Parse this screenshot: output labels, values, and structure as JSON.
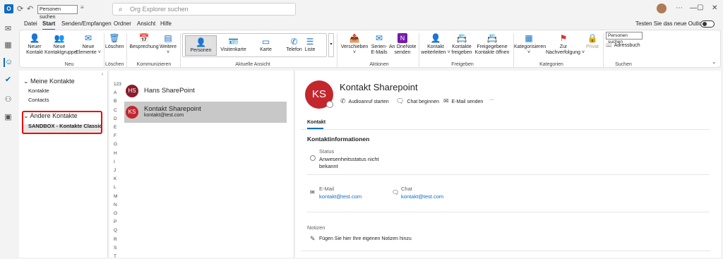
{
  "titlebar": {
    "quick_search": "Personen suchen",
    "search_placeholder": "Org Explorer suchen"
  },
  "menu": {
    "tabs": [
      "Datei",
      "Start",
      "Senden/Empfangen",
      "Ordner",
      "Ansicht",
      "Hilfe"
    ],
    "active_tab": "Start",
    "try_new": "Testen Sie das neue Outlook"
  },
  "ribbon": {
    "neu": {
      "group": "Neu",
      "new_contact": [
        "Neuer",
        "Kontakt"
      ],
      "new_group": [
        "Neue",
        "Kontaktgruppe"
      ],
      "new_items": [
        "Neue",
        "Elemente ˅"
      ]
    },
    "loeschen": {
      "group": "Löschen",
      "delete": "Löschen"
    },
    "kommunikation": {
      "group": "Kommunizieren",
      "meeting": "Besprechung",
      "more": [
        "Weitere",
        "˅"
      ]
    },
    "ansicht": {
      "group": "Aktuelle Ansicht",
      "views": [
        "Personen",
        "Visitenkarte",
        "Karte",
        "Telefon",
        "Liste"
      ]
    },
    "aktionen": {
      "group": "Aktionen",
      "move": [
        "Verschieben",
        "˅"
      ],
      "mail": [
        "Serien-",
        "E-Mails"
      ],
      "onenote": [
        "An OneNote",
        "senden"
      ]
    },
    "freigeben": {
      "group": "Freigeben",
      "forward": [
        "Kontakt",
        "weiterleiten ˅"
      ],
      "share": [
        "Kontakte",
        "freigeben"
      ],
      "open_shared": [
        "Freigegebene",
        "Kontakte öffnen"
      ]
    },
    "kategorien": {
      "group": "Kategorien",
      "categorize": [
        "Kategorisieren",
        "˅"
      ],
      "followup": [
        "Zur",
        "Nachverfolgung ˅"
      ],
      "private": "Privat"
    },
    "suchen": {
      "group": "Suchen",
      "search_input": "Personen suchen",
      "addressbook": "Adressbuch"
    }
  },
  "folders": {
    "group1": "Meine Kontakte",
    "group1_items": [
      "Kontakte",
      "Contacts"
    ],
    "group2": "Andere Kontakte",
    "group2_items": [
      "SANDBOX - Kontakte Classic"
    ]
  },
  "contact_list": {
    "letters": [
      "123",
      "A",
      "B",
      "C",
      "D",
      "E",
      "F",
      "G",
      "H",
      "I",
      "J",
      "K",
      "L",
      "M",
      "N",
      "O",
      "P",
      "Q",
      "R",
      "S",
      "T"
    ],
    "items": [
      {
        "initials": "HS",
        "name": "Hans SharePoint",
        "email": "",
        "color": "#8a1c2b"
      },
      {
        "initials": "KS",
        "name": "Kontakt Sharepoint",
        "email": "kontakt@test.com",
        "color": "#c4262e"
      }
    ]
  },
  "detail": {
    "initials": "KS",
    "avatar_color": "#c4262e",
    "name": "Kontakt Sharepoint",
    "actions": [
      "Audioanruf starten",
      "Chat beginnen",
      "E-Mail senden",
      "···"
    ],
    "tab": "Kontakt",
    "section": "Kontaktinformationen",
    "status_label": "Status",
    "status_value": [
      "Anwesenheitsstatus nicht",
      "bekannt"
    ],
    "email_label": "E-Mail",
    "email_value": "kontakt@test.com",
    "chat_label": "Chat",
    "chat_value": "kontakt@test.com",
    "notes_label": "Notizen",
    "notes_placeholder": "Fügen Sie hier Ihre eigenen Notizen hinzu"
  },
  "colors": {
    "accent": "#0f6cbd",
    "highlight": "#ee0000"
  }
}
